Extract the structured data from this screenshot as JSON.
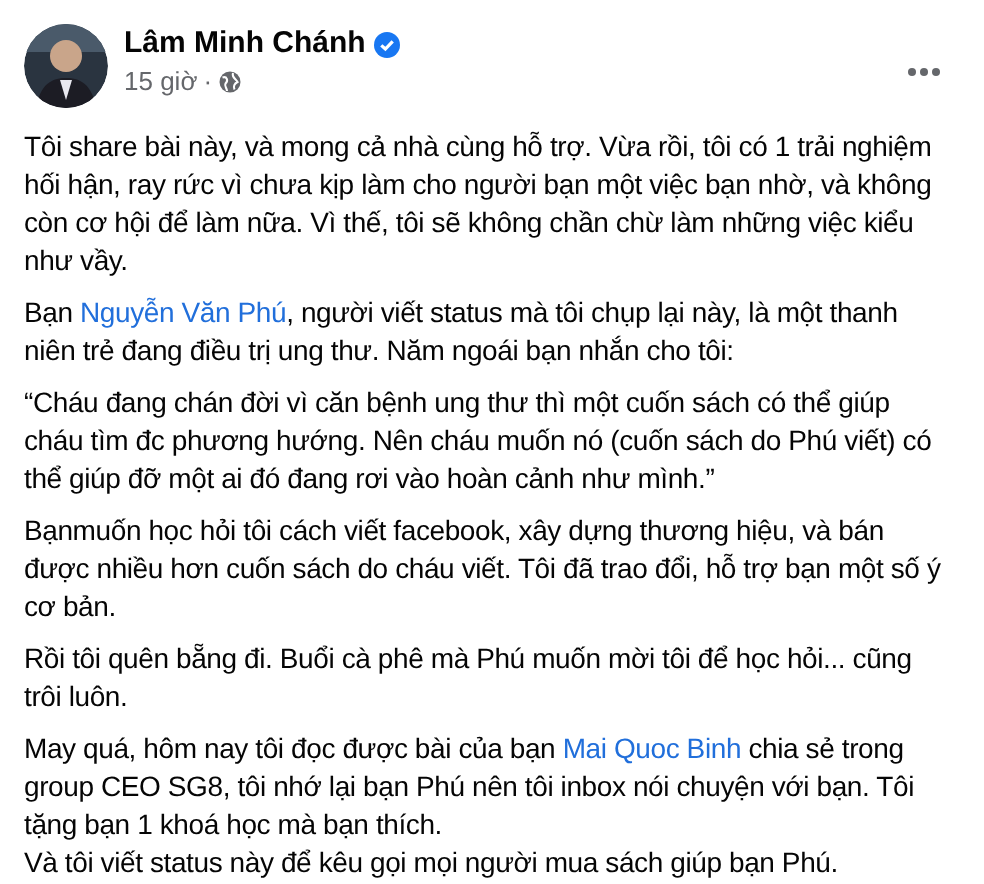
{
  "post": {
    "author": "Lâm Minh Chánh",
    "verified": true,
    "time": "15 giờ",
    "separator": "·",
    "paragraphs": [
      {
        "lines": [
          [
            {
              "kind": "plain",
              "text": "Tôi share bài này, và mong cả nhà cùng hỗ trợ. Vừa rồi, tôi có 1 trải nghiệm hối hận, ray rức vì chưa kịp làm cho người bạn một việc bạn nhờ, và không còn cơ hội để làm nữa. Vì thế, tôi sẽ không chần chừ làm những việc kiểu như vầy."
            }
          ]
        ]
      },
      {
        "lines": [
          [
            {
              "kind": "plain",
              "text": "Bạn "
            },
            {
              "kind": "link",
              "text": "Nguyễn Văn Phú"
            },
            {
              "kind": "plain",
              "text": ", người viết status mà tôi chụp lại này, là một thanh niên trẻ đang điều trị ung thư. Năm ngoái bạn nhắn cho tôi:"
            }
          ]
        ]
      },
      {
        "lines": [
          [
            {
              "kind": "plain",
              "text": "“Cháu đang chán đời vì căn bệnh ung thư thì một cuốn sách có thể giúp cháu tìm đc phương hướng. Nên cháu muốn nó (cuốn sách do Phú viết) có thể giúp đỡ một ai đó đang rơi vào hoàn cảnh như mình.”"
            }
          ]
        ]
      },
      {
        "lines": [
          [
            {
              "kind": "plain",
              "text": "Bạnmuốn học hỏi tôi cách viết facebook, xây dựng thương hiệu, và bán được nhiều hơn cuốn sách do cháu viết. Tôi đã trao đổi,  hỗ trợ bạn một số ý cơ bản."
            }
          ]
        ]
      },
      {
        "lines": [
          [
            {
              "kind": "plain",
              "text": "Rồi tôi quên bẵng đi. Buổi cà phê mà Phú muốn mời tôi để học hỏi... cũng trôi luôn."
            }
          ]
        ]
      },
      {
        "lines": [
          [
            {
              "kind": "plain",
              "text": "May quá, hôm nay tôi đọc được bài của bạn "
            },
            {
              "kind": "link",
              "text": "Mai Quoc Binh"
            },
            {
              "kind": "plain",
              "text": " chia sẻ trong group CEO SG8, tôi nhớ lại bạn Phú nên tôi inbox nói chuyện với bạn. Tôi tặng bạn 1 khoá học mà bạn thích."
            }
          ],
          [
            {
              "kind": "plain",
              "text": "Và tôi viết status này để kêu gọi mọi người mua sách giúp bạn Phú."
            }
          ]
        ]
      }
    ]
  }
}
